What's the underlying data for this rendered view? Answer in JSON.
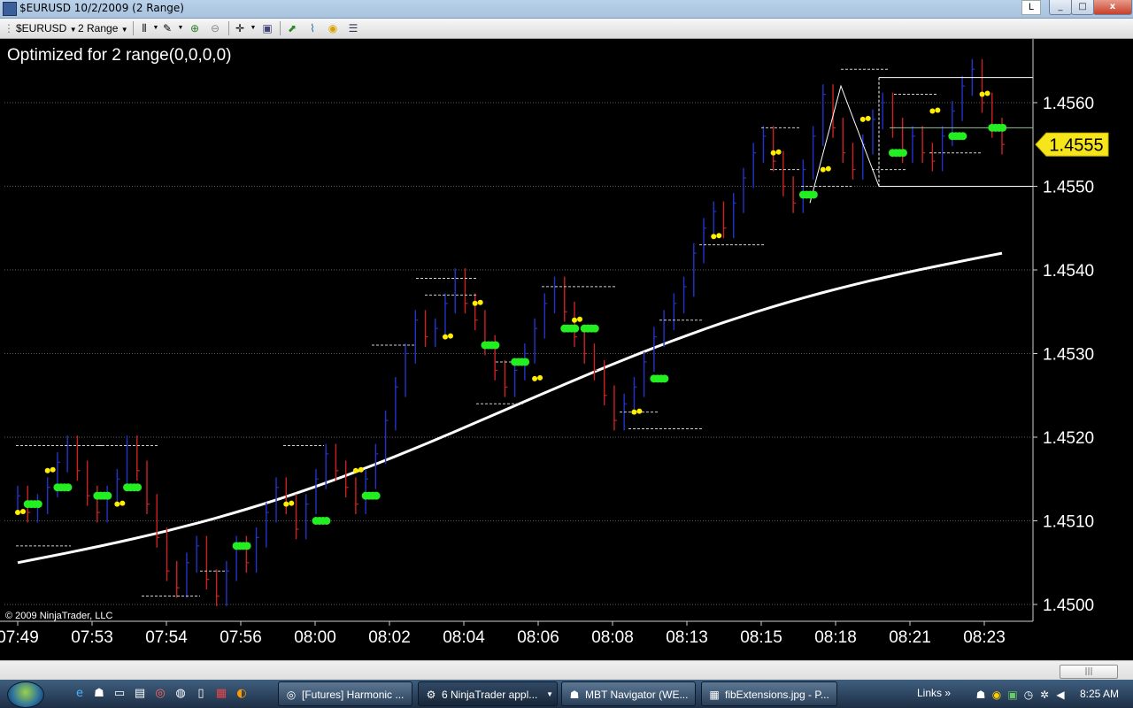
{
  "window": {
    "title": "$EURUSD  10/2/2009 (2 Range)",
    "badge": "L",
    "minimize": "_",
    "maximize": "□",
    "close": "x"
  },
  "toolbar": {
    "instrument": "$EURUSD",
    "period": "2 Range"
  },
  "chart": {
    "strategy_label": "Optimized for 2 range(0,0,0,0)",
    "copyright": "© 2009 NinjaTrader, LLC",
    "price_marker": "1.4555",
    "colors": {
      "up": "#2233cc",
      "down": "#cc2222",
      "green_dot": "#22ee22",
      "yellow_dot": "#ffee00",
      "ma": "#ffffff",
      "marker": "#f6e51a"
    }
  },
  "chart_data": {
    "type": "ohlc",
    "title": "Optimized for 2 range(0,0,0,0)",
    "x_tick_labels": [
      "07:49",
      "07:53",
      "07:54",
      "07:56",
      "08:00",
      "08:02",
      "08:04",
      "08:06",
      "08:08",
      "08:13",
      "08:15",
      "08:18",
      "08:21",
      "08:23"
    ],
    "y_ticks": [
      1.45,
      1.451,
      1.452,
      1.453,
      1.454,
      1.455,
      1.456
    ],
    "y_tick_labels": [
      "1.4500",
      "1.4510",
      "1.4520",
      "1.4530",
      "1.4540",
      "1.4550",
      "1.4560"
    ],
    "ylim": [
      1.4498,
      1.4566
    ],
    "last_price": 1.4555,
    "gridlines": "horizontal dotted",
    "bars": [
      1.4513,
      1.4511,
      1.4512,
      1.4514,
      1.4517,
      1.4519,
      1.4516,
      1.4513,
      1.4511,
      1.4513,
      1.4515,
      1.4519,
      1.4516,
      1.4512,
      1.4508,
      1.4504,
      1.4502,
      1.4505,
      1.4507,
      1.4503,
      1.4501,
      1.4504,
      1.4507,
      1.4505,
      1.4508,
      1.4511,
      1.4514,
      1.4512,
      1.4509,
      1.4512,
      1.4515,
      1.4518,
      1.4516,
      1.4514,
      1.4512,
      1.4515,
      1.4518,
      1.4522,
      1.4526,
      1.453,
      1.4534,
      1.4532,
      1.4533,
      1.4536,
      1.4539,
      1.4536,
      1.4534,
      1.4531,
      1.4528,
      1.4526,
      1.4528,
      1.453,
      1.4533,
      1.4536,
      1.4538,
      1.4535,
      1.4532,
      1.453,
      1.4528,
      1.4525,
      1.4522,
      1.4524,
      1.4526,
      1.4529,
      1.4532,
      1.4534,
      1.4536,
      1.4538,
      1.4542,
      1.4545,
      1.4547,
      1.4545,
      1.4548,
      1.4551,
      1.4554,
      1.4556,
      1.4553,
      1.455,
      1.4548,
      1.4552,
      1.4556,
      1.4561,
      1.4557,
      1.4554,
      1.4552,
      1.4555,
      1.4558,
      1.456,
      1.4557,
      1.4554,
      1.4556,
      1.4554,
      1.4553,
      1.4556,
      1.4559,
      1.4562,
      1.4564,
      1.456,
      1.4557,
      1.4555
    ],
    "moving_average": {
      "start": 1.4505,
      "end": 1.4542
    },
    "green_signals": [
      [
        1,
        1.4512
      ],
      [
        4,
        1.4514
      ],
      [
        8,
        1.4513
      ],
      [
        11,
        1.4514
      ],
      [
        22,
        1.4507
      ],
      [
        30,
        1.451
      ],
      [
        35,
        1.4513
      ],
      [
        47,
        1.4531
      ],
      [
        50,
        1.4529
      ],
      [
        55,
        1.4533
      ],
      [
        57,
        1.4533
      ],
      [
        64,
        1.4527
      ],
      [
        79,
        1.4549
      ],
      [
        88,
        1.4554
      ],
      [
        94,
        1.4556
      ],
      [
        98,
        1.4557
      ]
    ],
    "yellow_signals": [
      [
        0,
        1.4511
      ],
      [
        3,
        1.4516
      ],
      [
        10,
        1.4512
      ],
      [
        27,
        1.4512
      ],
      [
        34,
        1.4516
      ],
      [
        43,
        1.4532
      ],
      [
        46,
        1.4536
      ],
      [
        52,
        1.4527
      ],
      [
        56,
        1.4534
      ],
      [
        62,
        1.4523
      ],
      [
        70,
        1.4544
      ],
      [
        76,
        1.4554
      ],
      [
        81,
        1.4552
      ],
      [
        85,
        1.4558
      ],
      [
        92,
        1.4559
      ],
      [
        97,
        1.4561
      ]
    ]
  },
  "scrollbar": {
    "thumb_label": "|||"
  },
  "taskbar": {
    "items": [
      {
        "label": "[Futures] Harmonic ...",
        "icon": "chrome-icon"
      },
      {
        "label": "6 NinjaTrader appl...",
        "icon": "ninjatrader-icon"
      },
      {
        "label": "MBT Navigator (WE...",
        "icon": "mbt-icon"
      },
      {
        "label": "fibExtensions.jpg - P...",
        "icon": "paint-icon"
      }
    ],
    "links": "Links",
    "links_chevron": "»",
    "clock": "8:25 AM"
  }
}
